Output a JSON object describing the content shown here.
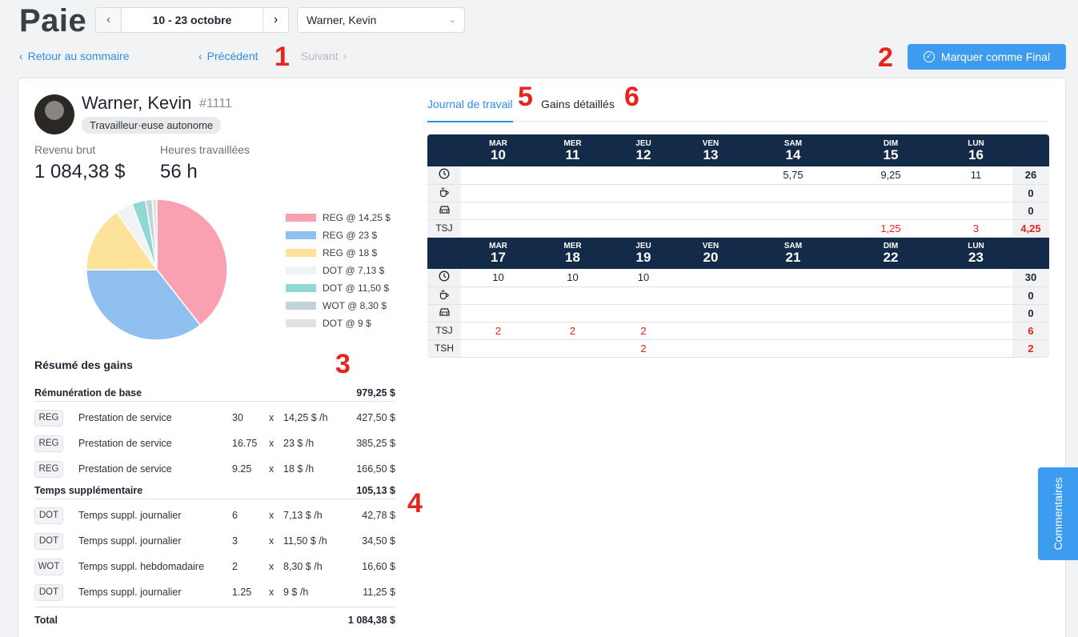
{
  "header": {
    "title": "Paie",
    "date_range": "10 - 23 octobre",
    "employee_select": "Warner, Kevin"
  },
  "subnav": {
    "back": "Retour au sommaire",
    "previous": "Précédent",
    "next": "Suivant"
  },
  "markers": {
    "m1": "1",
    "m2": "2",
    "m3": "3",
    "m4": "4",
    "m5": "5",
    "m6": "6"
  },
  "actions": {
    "mark_final": "Marquer comme Final"
  },
  "employee": {
    "name": "Warner, Kevin",
    "id": "#1111",
    "type": "Travailleur·euse autonome"
  },
  "kpis": {
    "gross_label": "Revenu brut",
    "gross_value": "1 084,38 $",
    "hours_label": "Heures travaillées",
    "hours_value": "56 h"
  },
  "chart_data": {
    "type": "pie",
    "labels": [
      "REG @ 14,25 $",
      "REG @ 23 $",
      "REG @ 18 $",
      "DOT @ 7,13 $",
      "DOT @ 11,50 $",
      "WOT @ 8,30 $",
      "DOT @ 9 $"
    ],
    "values": [
      427.5,
      385.25,
      166.5,
      42.78,
      34.5,
      16.6,
      11.25
    ],
    "colors": [
      "#f9a1b1",
      "#8fc0ef",
      "#fde29a",
      "#f1f2f4",
      "#90d8d1",
      "#c2d3dc",
      "#e2e2e2"
    ]
  },
  "earnings": {
    "title": "Résumé des gains",
    "base": {
      "label": "Rémunération de base",
      "total": "979,25 $",
      "rows": [
        {
          "tag": "REG",
          "desc": "Prestation de service",
          "qty": "30",
          "x": "x",
          "rate": "14,25 $ /h",
          "amount": "427,50 $"
        },
        {
          "tag": "REG",
          "desc": "Prestation de service",
          "qty": "16.75",
          "x": "x",
          "rate": "23 $ /h",
          "amount": "385,25 $"
        },
        {
          "tag": "REG",
          "desc": "Prestation de service",
          "qty": "9.25",
          "x": "x",
          "rate": "18 $ /h",
          "amount": "166,50 $"
        }
      ]
    },
    "overtime": {
      "label": "Temps supplémentaire",
      "total": "105,13 $",
      "rows": [
        {
          "tag": "DOT",
          "desc": "Temps suppl. journalier",
          "qty": "6",
          "x": "x",
          "rate": "7,13 $ /h",
          "amount": "42,78 $"
        },
        {
          "tag": "DOT",
          "desc": "Temps suppl. journalier",
          "qty": "3",
          "x": "x",
          "rate": "11,50 $ /h",
          "amount": "34,50 $"
        },
        {
          "tag": "WOT",
          "desc": "Temps suppl. hebdomadaire",
          "qty": "2",
          "x": "x",
          "rate": "8,30 $ /h",
          "amount": "16,60 $"
        },
        {
          "tag": "DOT",
          "desc": "Temps suppl. journalier",
          "qty": "1.25",
          "x": "x",
          "rate": "9 $ /h",
          "amount": "11,25 $"
        }
      ]
    },
    "total_label": "Total",
    "total_value": "1 084,38 $"
  },
  "tabs": {
    "journal": "Journal de travail",
    "details": "Gains détaillés"
  },
  "journal": {
    "weeks": [
      {
        "days": [
          {
            "dow": "MAR",
            "num": "10"
          },
          {
            "dow": "MER",
            "num": "11"
          },
          {
            "dow": "JEU",
            "num": "12"
          },
          {
            "dow": "VEN",
            "num": "13"
          },
          {
            "dow": "SAM",
            "num": "14"
          },
          {
            "dow": "DIM",
            "num": "15"
          },
          {
            "dow": "LUN",
            "num": "16"
          }
        ],
        "rows": [
          {
            "head": "clock-icon",
            "label": "",
            "cells": [
              "",
              "",
              "",
              "",
              "5,75",
              "9,25",
              "11"
            ],
            "total": "26",
            "red": false
          },
          {
            "head": "coffee-icon",
            "label": "",
            "cells": [
              "",
              "",
              "",
              "",
              "",
              "",
              ""
            ],
            "total": "0",
            "red": false
          },
          {
            "head": "car-icon",
            "label": "",
            "cells": [
              "",
              "",
              "",
              "",
              "",
              "",
              ""
            ],
            "total": "0",
            "red": false
          },
          {
            "head": "text",
            "label": "TSJ",
            "cells": [
              "",
              "",
              "",
              "",
              "",
              "1,25",
              "3"
            ],
            "total": "4,25",
            "red": true
          }
        ]
      },
      {
        "days": [
          {
            "dow": "MAR",
            "num": "17"
          },
          {
            "dow": "MER",
            "num": "18"
          },
          {
            "dow": "JEU",
            "num": "19"
          },
          {
            "dow": "VEN",
            "num": "20"
          },
          {
            "dow": "SAM",
            "num": "21"
          },
          {
            "dow": "DIM",
            "num": "22"
          },
          {
            "dow": "LUN",
            "num": "23"
          }
        ],
        "rows": [
          {
            "head": "clock-icon",
            "label": "",
            "cells": [
              "10",
              "10",
              "10",
              "",
              "",
              "",
              ""
            ],
            "total": "30",
            "red": false
          },
          {
            "head": "coffee-icon",
            "label": "",
            "cells": [
              "",
              "",
              "",
              "",
              "",
              "",
              ""
            ],
            "total": "0",
            "red": false
          },
          {
            "head": "car-icon",
            "label": "",
            "cells": [
              "",
              "",
              "",
              "",
              "",
              "",
              ""
            ],
            "total": "0",
            "red": false
          },
          {
            "head": "text",
            "label": "TSJ",
            "cells": [
              "2",
              "2",
              "2",
              "",
              "",
              "",
              ""
            ],
            "total": "6",
            "red": true
          },
          {
            "head": "text",
            "label": "TSH",
            "cells": [
              "",
              "",
              "2",
              "",
              "",
              "",
              ""
            ],
            "total": "2",
            "red": true
          }
        ]
      }
    ]
  },
  "comments": {
    "label": "Commentaires"
  },
  "colors": {
    "accent": "#3d9cf0",
    "navy": "#132a48",
    "alert": "#e8231c"
  }
}
